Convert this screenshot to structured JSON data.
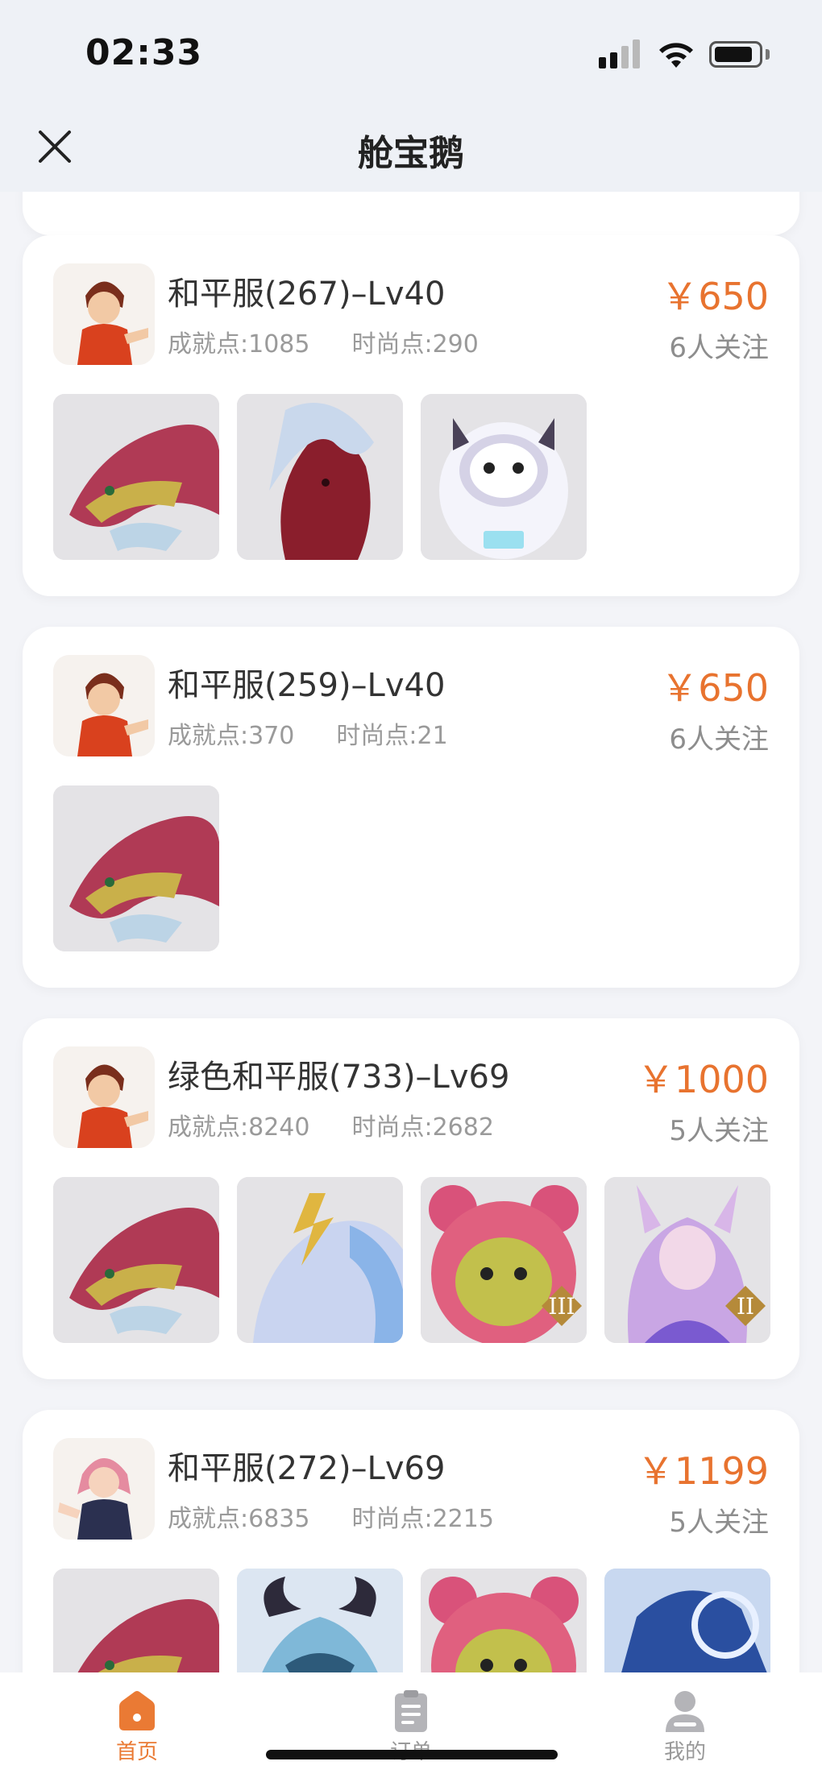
{
  "status_bar": {
    "time": "02:33"
  },
  "nav": {
    "title": "舱宝鹅"
  },
  "listings": [
    {
      "title": "和平服(267)–Lv40",
      "achievement": "成就点:1085",
      "fashion": "时尚点:290",
      "price": "￥650",
      "followers": "6人关注",
      "avatar": "boy-fighter",
      "items": [
        "red-dragon-mount",
        "red-horse-mount",
        "cow-astronaut-pet"
      ]
    },
    {
      "title": "和平服(259)–Lv40",
      "achievement": "成就点:370",
      "fashion": "时尚点:21",
      "price": "￥650",
      "followers": "6人关注",
      "avatar": "boy-fighter",
      "items": [
        "red-dragon-mount"
      ]
    },
    {
      "title": "绿色和平服(733)–Lv69",
      "achievement": "成就点:8240",
      "fashion": "时尚点:2682",
      "price": "￥1000",
      "followers": "5人关注",
      "avatar": "boy-fighter",
      "items": [
        "red-dragon-mount",
        "ice-horse-mount",
        "pink-bear-pet-III",
        "fox-girl-skin-II"
      ]
    },
    {
      "title": "和平服(272)–Lv69",
      "achievement": "成就点:6835",
      "fashion": "时尚点:2215",
      "price": "￥1199",
      "followers": "5人关注",
      "avatar": "girl-fighter",
      "items": [
        "red-dragon-mount",
        "blue-dragon-mount",
        "pink-bear-pet",
        "blue-armor-skin"
      ]
    }
  ],
  "tab_bar": {
    "tabs": [
      {
        "label": "首页",
        "icon": "home-icon",
        "active": true
      },
      {
        "label": "订单",
        "icon": "order-icon",
        "active": false
      },
      {
        "label": "我的",
        "icon": "profile-icon",
        "active": false
      }
    ]
  },
  "colors": {
    "accent": "#e8732f",
    "background": "#f3f4f8"
  }
}
